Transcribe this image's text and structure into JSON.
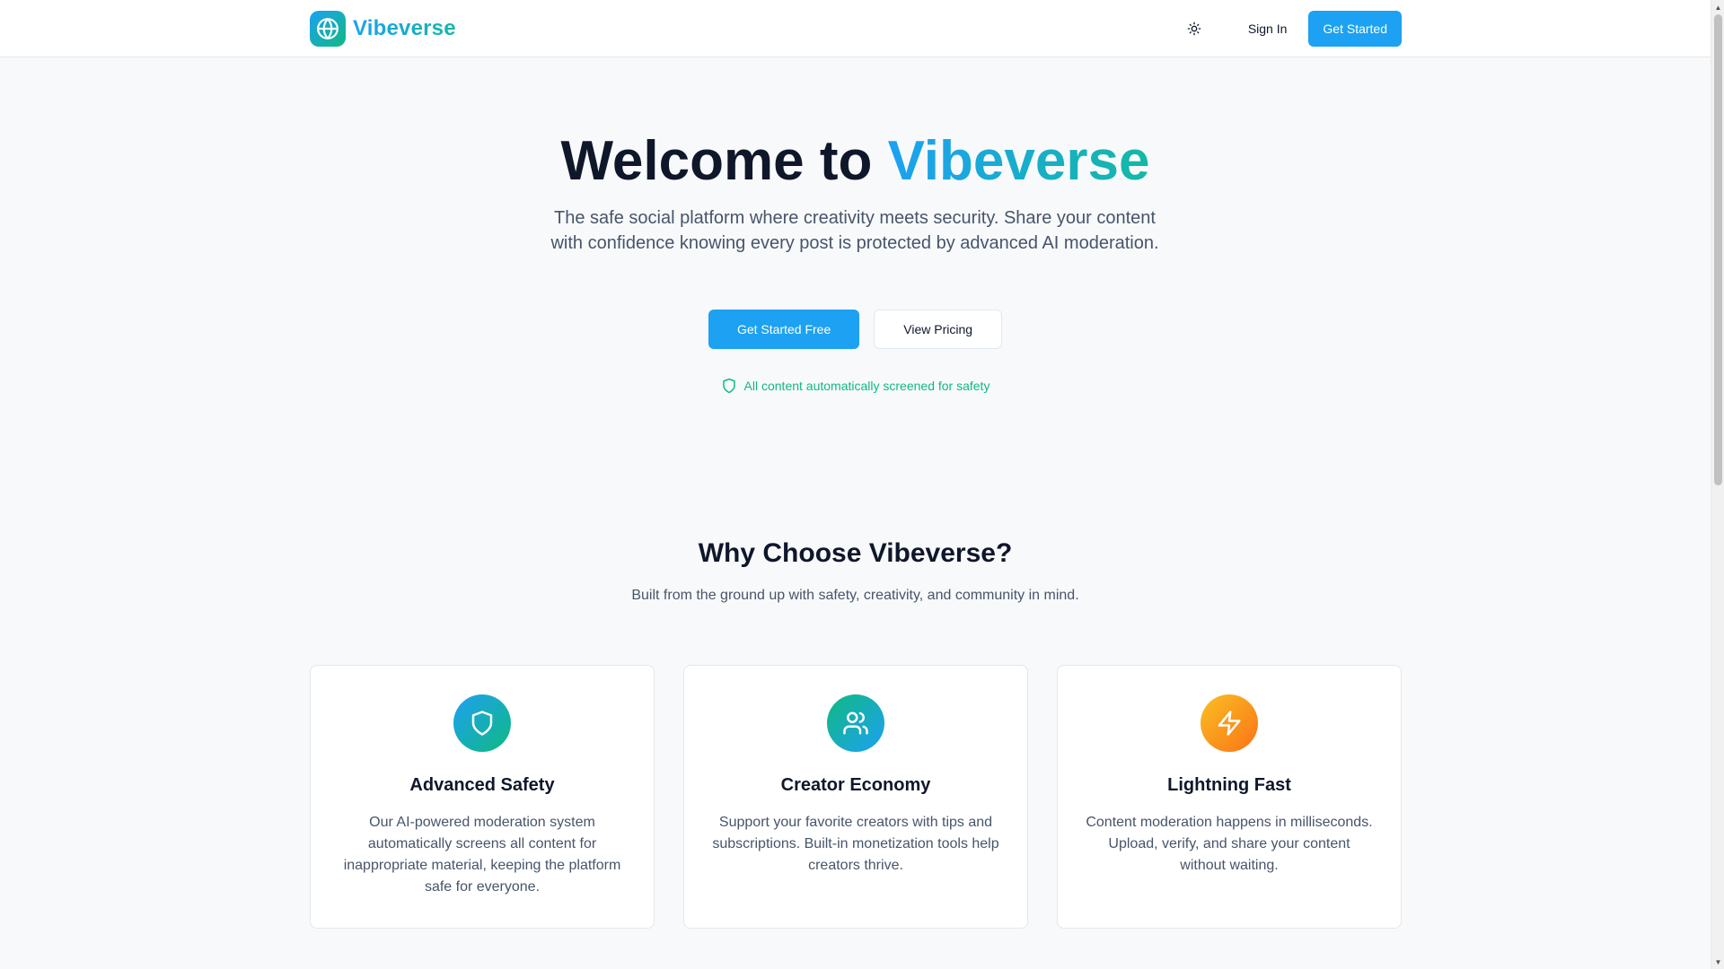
{
  "header": {
    "brand_name": "Vibeverse",
    "logo_icon": "globe-icon",
    "theme_icon": "sun-icon",
    "sign_in_label": "Sign In",
    "get_started_label": "Get Started"
  },
  "hero": {
    "title_prefix": "Welcome to ",
    "title_accent": "Vibeverse",
    "subtitle": "The safe social platform where creativity meets security. Share your content with confidence knowing every post is protected by advanced AI moderation.",
    "primary_cta": "Get Started Free",
    "secondary_cta": "View Pricing",
    "safety_note": "All content automatically screened for safety",
    "safety_icon": "shield-icon"
  },
  "features": {
    "title": "Why Choose Vibeverse?",
    "subtitle": "Built from the ground up with safety, creativity, and community in mind.",
    "cards": [
      {
        "icon": "shield-icon",
        "title": "Advanced Safety",
        "text": "Our AI-powered moderation system automatically screens all content for inappropriate material, keeping the platform safe for everyone."
      },
      {
        "icon": "users-icon",
        "title": "Creator Economy",
        "text": "Support your favorite creators with tips and subscriptions. Built-in monetization tools help creators thrive."
      },
      {
        "icon": "lightning-icon",
        "title": "Lightning Fast",
        "text": "Content moderation happens in milliseconds. Upload, verify, and share your content without waiting."
      }
    ]
  },
  "colors": {
    "primary": "#1da1f2",
    "accent_green": "#10b981",
    "accent_orange": "#f97316",
    "text_dark": "#0f172a",
    "text_muted": "#475569"
  }
}
